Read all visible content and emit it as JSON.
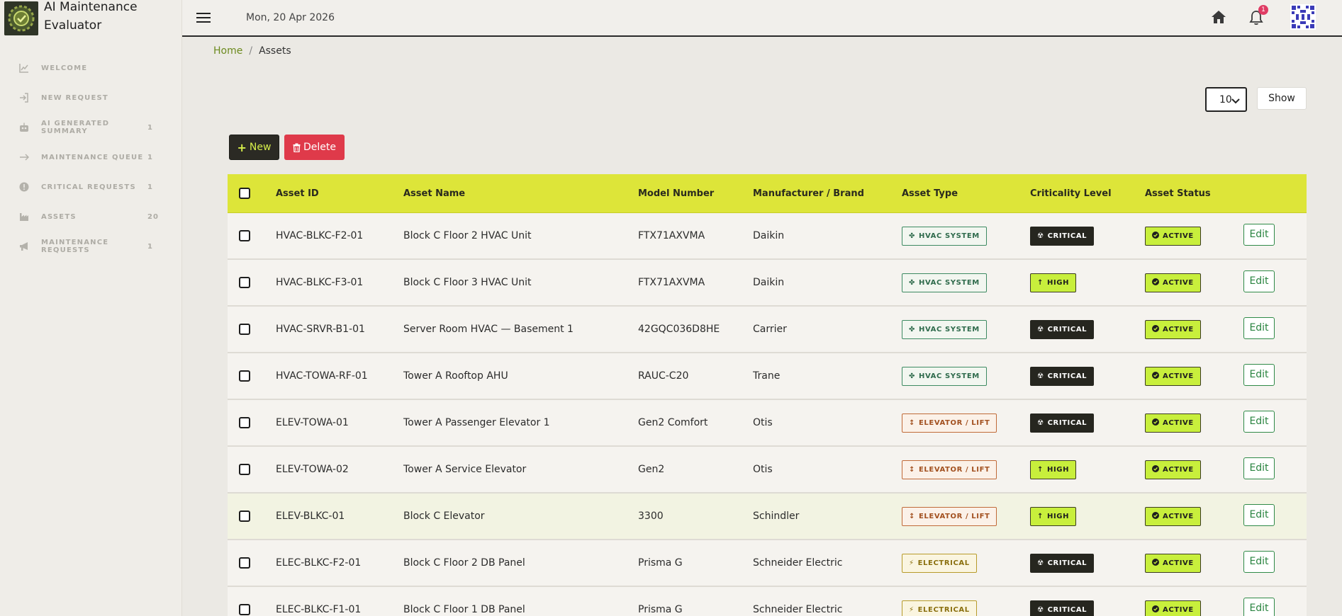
{
  "app": {
    "title_line1": "AI Maintenance",
    "title_line2": "Evaluator",
    "logo_icon": "gear-logo-icon"
  },
  "topbar": {
    "date": "Mon, 20 Apr 2026",
    "notification_count": "1"
  },
  "sidebar": {
    "items": [
      {
        "label": "WELCOME",
        "count": "",
        "icon": "chart-line-icon"
      },
      {
        "label": "NEW REQUEST",
        "count": "",
        "icon": "sign-in-icon"
      },
      {
        "label": "AI GENERATED SUMMARY",
        "count": "1",
        "icon": "robot-icon"
      },
      {
        "label": "MAINTENANCE QUEUE",
        "count": "1",
        "icon": "arrow-right-icon"
      },
      {
        "label": "CRITICAL REQUESTS",
        "count": "1",
        "icon": "exclamation-circle-icon"
      },
      {
        "label": "ASSETS",
        "count": "20",
        "icon": "industry-icon"
      },
      {
        "label": "MAINTENANCE REQUESTS",
        "count": "1",
        "icon": "megaphone-icon"
      }
    ]
  },
  "breadcrumb": {
    "home": "Home",
    "separator": "/",
    "current": "Assets"
  },
  "pagination": {
    "per_page": "10",
    "show_label": "Show"
  },
  "actions": {
    "new_label": "New",
    "delete_label": "Delete"
  },
  "table": {
    "headers": {
      "asset_id": "Asset ID",
      "asset_name": "Asset Name",
      "model_number": "Model Number",
      "manufacturer": "Manufacturer / Brand",
      "asset_type": "Asset Type",
      "criticality": "Criticality Level",
      "status": "Asset Status"
    },
    "edit_label": "Edit",
    "rows": [
      {
        "id": "HVAC-BLKC-F2-01",
        "name": "Block C Floor 2 HVAC Unit",
        "model": "FTX71AXVMA",
        "brand": "Daikin",
        "type": "HVAC SYSTEM",
        "type_kind": "hvac",
        "crit": "CRITICAL",
        "crit_kind": "critical",
        "status": "ACTIVE"
      },
      {
        "id": "HVAC-BLKC-F3-01",
        "name": "Block C Floor 3 HVAC Unit",
        "model": "FTX71AXVMA",
        "brand": "Daikin",
        "type": "HVAC SYSTEM",
        "type_kind": "hvac",
        "crit": "HIGH",
        "crit_kind": "high",
        "status": "ACTIVE"
      },
      {
        "id": "HVAC-SRVR-B1-01",
        "name": "Server Room HVAC — Basement 1",
        "model": "42GQC036D8HE",
        "brand": "Carrier",
        "type": "HVAC SYSTEM",
        "type_kind": "hvac",
        "crit": "CRITICAL",
        "crit_kind": "critical",
        "status": "ACTIVE"
      },
      {
        "id": "HVAC-TOWA-RF-01",
        "name": "Tower A Rooftop AHU",
        "model": "RAUC-C20",
        "brand": "Trane",
        "type": "HVAC SYSTEM",
        "type_kind": "hvac",
        "crit": "CRITICAL",
        "crit_kind": "critical",
        "status": "ACTIVE"
      },
      {
        "id": "ELEV-TOWA-01",
        "name": "Tower A Passenger Elevator 1",
        "model": "Gen2 Comfort",
        "brand": "Otis",
        "type": "ELEVATOR / LIFT",
        "type_kind": "elev",
        "crit": "CRITICAL",
        "crit_kind": "critical",
        "status": "ACTIVE"
      },
      {
        "id": "ELEV-TOWA-02",
        "name": "Tower A Service Elevator",
        "model": "Gen2",
        "brand": "Otis",
        "type": "ELEVATOR / LIFT",
        "type_kind": "elev",
        "crit": "HIGH",
        "crit_kind": "high",
        "status": "ACTIVE"
      },
      {
        "id": "ELEV-BLKC-01",
        "name": "Block C Elevator",
        "model": "3300",
        "brand": "Schindler",
        "type": "ELEVATOR / LIFT",
        "type_kind": "elev",
        "crit": "HIGH",
        "crit_kind": "high",
        "status": "ACTIVE",
        "highlight": true
      },
      {
        "id": "ELEC-BLKC-F2-01",
        "name": "Block C Floor 2 DB Panel",
        "model": "Prisma G",
        "brand": "Schneider Electric",
        "type": "ELECTRICAL",
        "type_kind": "elec",
        "crit": "CRITICAL",
        "crit_kind": "critical",
        "status": "ACTIVE"
      },
      {
        "id": "ELEC-BLKC-F1-01",
        "name": "Block C Floor 1 DB Panel",
        "model": "Prisma G",
        "brand": "Schneider Electric",
        "type": "ELECTRICAL",
        "type_kind": "elec",
        "crit": "CRITICAL",
        "crit_kind": "critical",
        "status": "ACTIVE"
      }
    ]
  }
}
